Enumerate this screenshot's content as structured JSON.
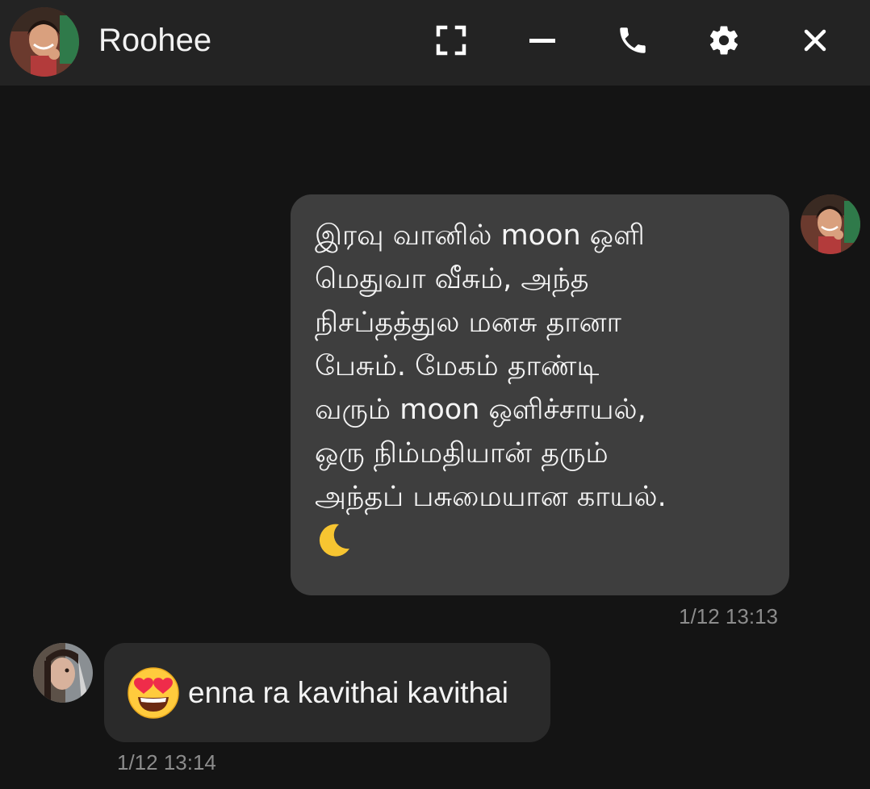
{
  "header": {
    "contact_name": "Roohee",
    "avatar_icon": "contact-avatar-icon",
    "buttons": [
      {
        "name": "expand-button",
        "icon": "fullscreen-icon"
      },
      {
        "name": "minimize-button",
        "icon": "minimize-icon"
      },
      {
        "name": "call-button",
        "icon": "phone-icon"
      },
      {
        "name": "settings-button",
        "icon": "gear-icon"
      },
      {
        "name": "close-button",
        "icon": "close-icon"
      }
    ]
  },
  "messages": [
    {
      "direction": "outgoing",
      "text": "இரவு வானில் moon ஒளி\nமெதுவா வீசும், அந்த\nநிசப்தத்துல மனசு தானா\nபேசும். மேகம் தாண்டி\nவரும் moon ஒளிச்சாயல்,\nஒரு நிம்மதியான் தரும்\nஅந்தப் பசுமையான காயல்.",
      "emoji": "crescent-moon-icon",
      "timestamp": "1/12 13:13"
    },
    {
      "direction": "incoming",
      "emoji": "heart-eyes-emoji-icon",
      "text": "enna ra kavithai kavithai",
      "timestamp": "1/12 13:14"
    }
  ],
  "colors": {
    "background": "#141414",
    "header": "#232323",
    "outgoing_bubble": "#3e3e3e",
    "incoming_bubble": "#2a2a2a",
    "timestamp": "#8c8c8c"
  }
}
